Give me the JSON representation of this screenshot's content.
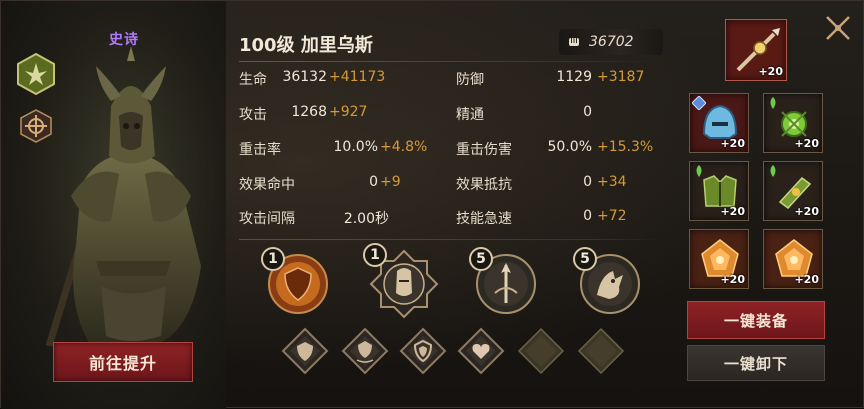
{
  "hero": {
    "rarity": "史诗",
    "title": "100级 加里乌斯",
    "power": "36702"
  },
  "stats": {
    "left": [
      {
        "label": "生命",
        "base": "36132",
        "bonus": "+41173"
      },
      {
        "label": "攻击",
        "base": "1268",
        "bonus": "+927"
      },
      {
        "label": "重击率",
        "base": "10.0%",
        "bonus": "+4.8%"
      },
      {
        "label": "效果命中",
        "base": "0",
        "bonus": "+9"
      },
      {
        "label": "攻击间隔",
        "base": "2.00秒",
        "bonus": ""
      }
    ],
    "right": [
      {
        "label": "防御",
        "base": "1129",
        "bonus": "+3187"
      },
      {
        "label": "精通",
        "base": "0",
        "bonus": ""
      },
      {
        "label": "重击伤害",
        "base": "50.0%",
        "bonus": "+15.3%"
      },
      {
        "label": "效果抵抗",
        "base": "0",
        "bonus": "+34"
      },
      {
        "label": "技能急速",
        "base": "0",
        "bonus": "+72"
      }
    ]
  },
  "skills": [
    {
      "level": "1",
      "icon": "shield-skill-icon"
    },
    {
      "level": "1",
      "icon": "knight-helm-skill-icon"
    },
    {
      "level": "5",
      "icon": "spear-skill-icon"
    },
    {
      "level": "5",
      "icon": "wolf-skill-icon"
    }
  ],
  "runes": [
    {
      "icon": "shield-rune-icon",
      "filled": true
    },
    {
      "icon": "shield-wave-rune-icon",
      "filled": true
    },
    {
      "icon": "shield-crest-rune-icon",
      "filled": true
    },
    {
      "icon": "heart-rune-icon",
      "filled": true
    },
    {
      "icon": "empty-rune-icon",
      "filled": false
    },
    {
      "icon": "empty-rune-icon",
      "filled": false
    }
  ],
  "equipment": {
    "weapon": {
      "level": "+20",
      "icon": "spear-weapon-icon"
    },
    "items": [
      {
        "level": "+20",
        "icon": "helmet-icon"
      },
      {
        "level": "+20",
        "icon": "green-amulet-icon"
      },
      {
        "level": "+20",
        "icon": "armor-icon"
      },
      {
        "level": "+20",
        "icon": "bracer-icon"
      },
      {
        "level": "+20",
        "icon": "fire-gem-icon"
      },
      {
        "level": "+20",
        "icon": "fire-gem-icon"
      }
    ]
  },
  "actions": {
    "promote": "前往提升",
    "equip_all": "一键装备",
    "unequip_all": "一键卸下"
  },
  "colors": {
    "bonus": "#d59a37",
    "rarity": "#b07bff",
    "primary_button": "#8e2225"
  }
}
